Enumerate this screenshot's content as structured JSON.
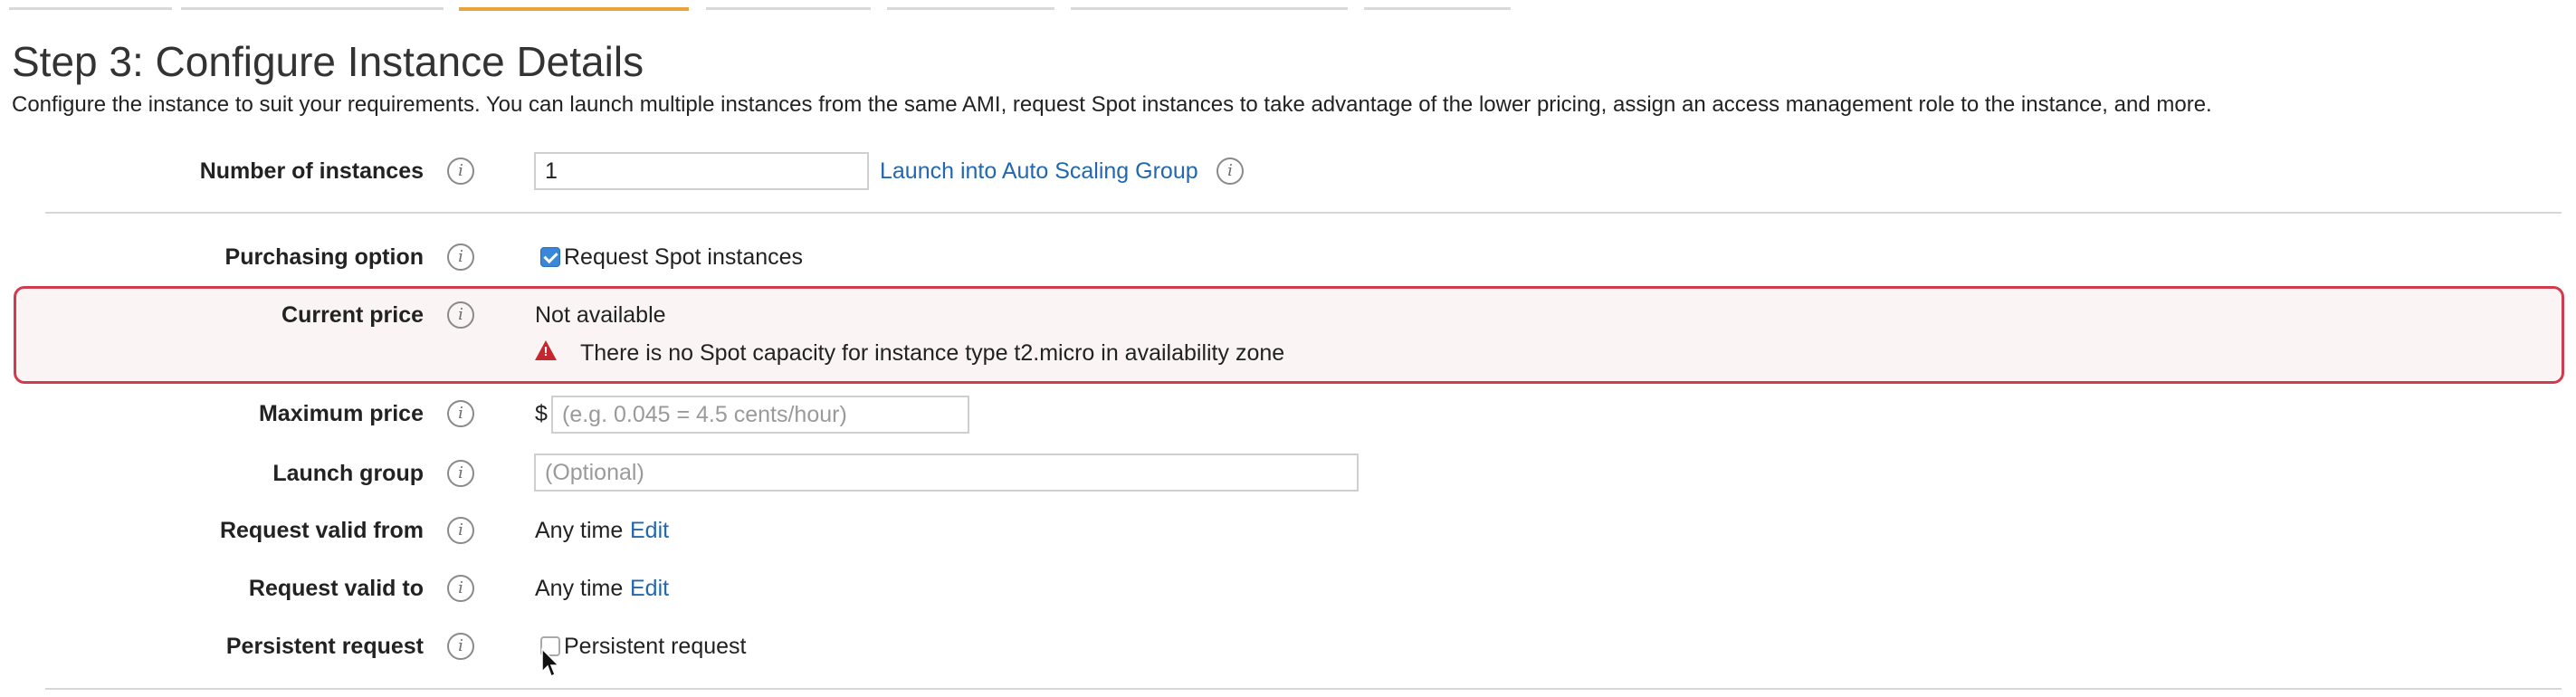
{
  "wizard_tabs": [
    "",
    "",
    "",
    "",
    "",
    "",
    ""
  ],
  "page": {
    "title": "Step 3: Configure Instance Details",
    "description": "Configure the instance to suit your requirements. You can launch multiple instances from the same AMI, request Spot instances to take advantage of the lower pricing, assign an access management role to the instance, and more."
  },
  "number_of_instances": {
    "label": "Number of instances",
    "value": "1",
    "auto_scaling_link": "Launch into Auto Scaling Group"
  },
  "purchasing_option": {
    "label": "Purchasing option",
    "checkbox_label": "Request Spot instances",
    "checked": true
  },
  "current_price": {
    "label": "Current price",
    "value": "Not available",
    "error_message": "There is no Spot capacity for instance type t2.micro in availability zone"
  },
  "maximum_price": {
    "label": "Maximum price",
    "currency": "$",
    "placeholder": "(e.g. 0.045 = 4.5 cents/hour)"
  },
  "launch_group": {
    "label": "Launch group",
    "placeholder": "(Optional)"
  },
  "request_valid_from": {
    "label": "Request valid from",
    "value": "Any time",
    "edit_link": "Edit"
  },
  "request_valid_to": {
    "label": "Request valid to",
    "value": "Any time",
    "edit_link": "Edit"
  },
  "persistent_request": {
    "label": "Persistent request",
    "checkbox_label": "Persistent request",
    "checked": false
  },
  "info_icon_glyph": "i",
  "colors": {
    "accent_tab": "#e8a33d",
    "link": "#2168b0",
    "error_border": "#d03c4e",
    "warning_icon": "#c6262e",
    "checkbox_checked": "#3a87d7"
  }
}
